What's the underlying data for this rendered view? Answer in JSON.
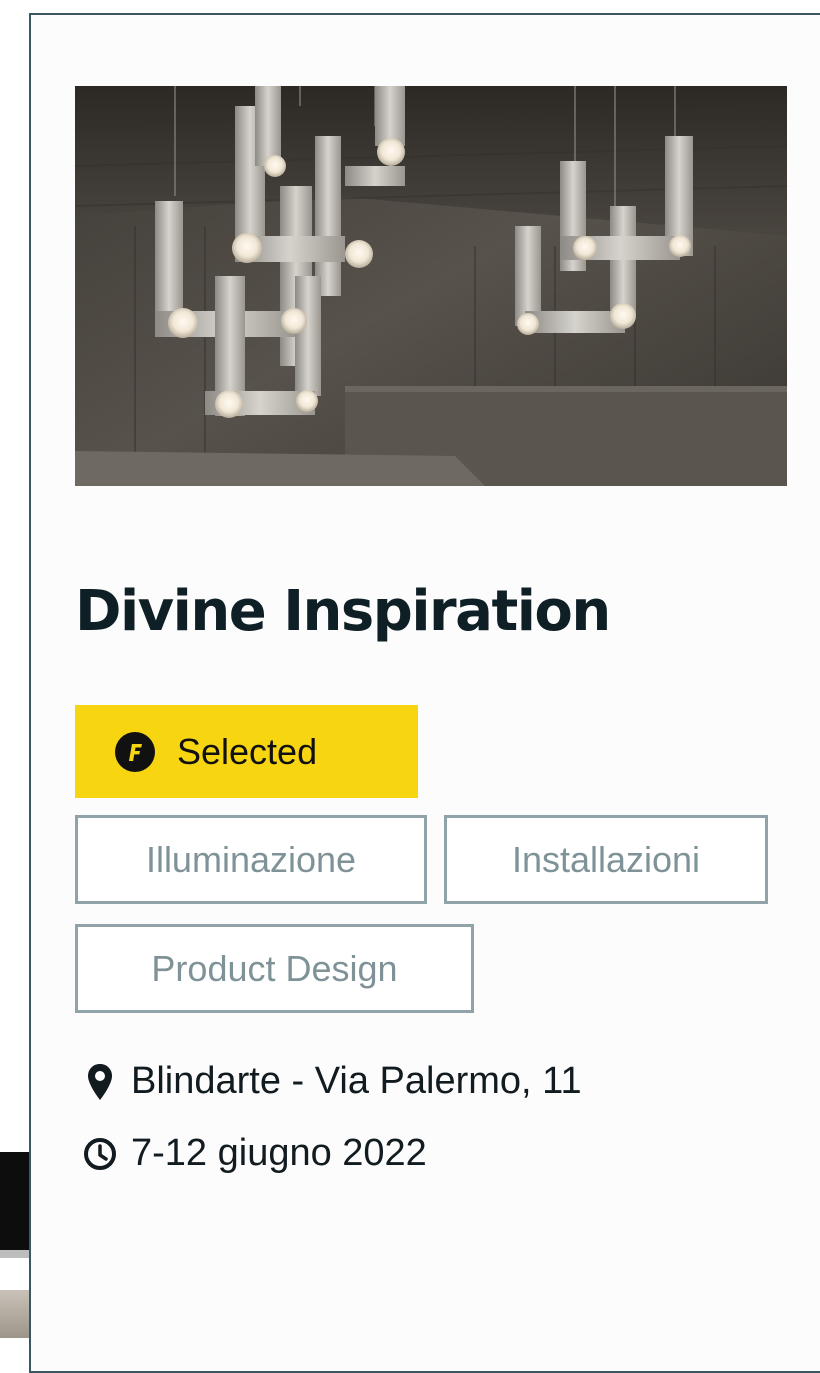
{
  "event": {
    "title": "Divine Inspiration",
    "badge": {
      "label": "Selected",
      "icon": "f-logo-icon",
      "color": "#f7d511"
    },
    "tags": [
      "Illuminazione",
      "Installazioni",
      "Product Design"
    ],
    "location": {
      "icon": "map-pin-icon",
      "text": "Blindarte - Via Palermo, 11"
    },
    "date": {
      "icon": "clock-icon",
      "text": "7-12 giugno 2022"
    }
  },
  "colors": {
    "card_border": "#3b5561",
    "title": "#0f1f26",
    "tag_border": "#8fa3a8",
    "tag_text": "#7e9297"
  }
}
